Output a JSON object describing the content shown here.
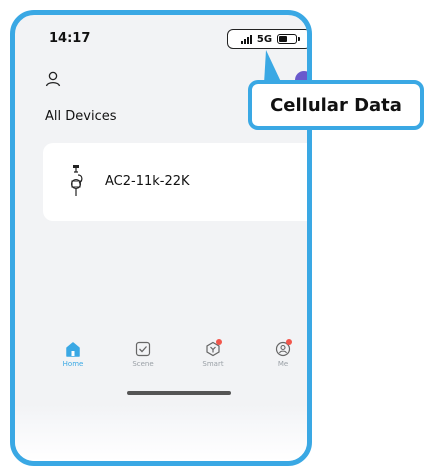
{
  "status_bar": {
    "time": "14:17",
    "network": "5G"
  },
  "header": {
    "profile_icon": "person-outline-icon",
    "add_icon": "add-circle-icon"
  },
  "section_title": "All Devices",
  "devices": [
    {
      "name": "AC2-11k-22K",
      "icon": "ev-charger-icon"
    }
  ],
  "tabbar": {
    "tabs": [
      {
        "label": "Home",
        "icon": "home-icon",
        "active": true
      },
      {
        "label": "Scene",
        "icon": "scene-check-icon",
        "active": false
      },
      {
        "label": "Smart",
        "icon": "smart-icon",
        "active": false,
        "badge": true
      },
      {
        "label": "Me",
        "icon": "me-icon",
        "active": false,
        "badge": true
      }
    ]
  },
  "callout": {
    "text": "Cellular Data"
  },
  "colors": {
    "accent": "#3aa8e4",
    "badge": "#f2564b",
    "background": "#f2f3f5"
  }
}
